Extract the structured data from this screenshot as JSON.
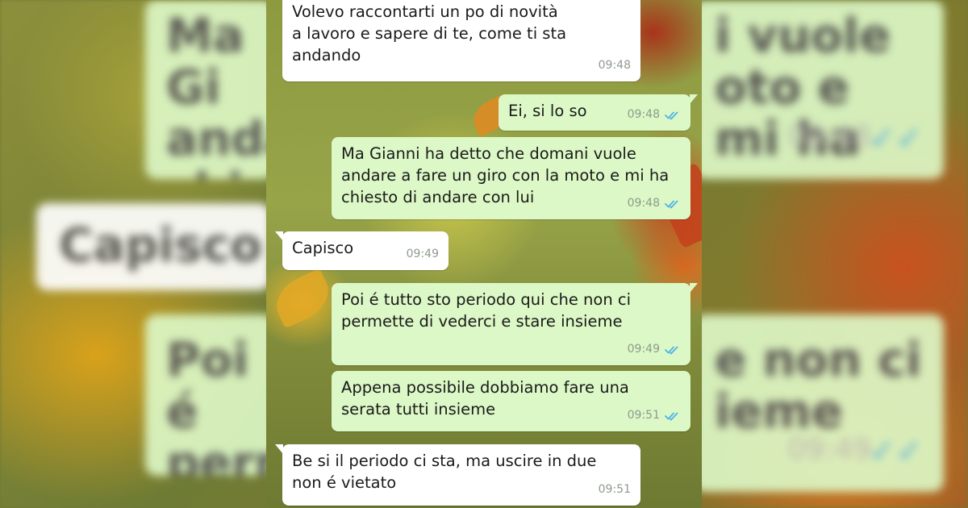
{
  "messages": [
    {
      "dir": "in",
      "text": "Volevo raccontarti un po di novità\na lavoro e sapere di te, come ti sta\nandando",
      "time": "09:48"
    },
    {
      "dir": "out",
      "text": "Ei, si lo so",
      "time": "09:48",
      "status": "read"
    },
    {
      "dir": "out",
      "text": "Ma Gianni ha detto che domani vuole\nandare a fare un giro con la moto e mi ha\nchiesto di andare con lui",
      "time": "09:48",
      "status": "read"
    },
    {
      "dir": "in",
      "text": "Capisco",
      "time": "09:49"
    },
    {
      "dir": "out",
      "text": "Poi é tutto sto periodo qui che non ci\npermette di vederci e stare insieme",
      "time": "09:49",
      "status": "read"
    },
    {
      "dir": "out",
      "text": "Appena possibile dobbiamo fare una\nserata tutti insieme",
      "time": "09:51",
      "status": "read"
    },
    {
      "dir": "in",
      "text": "Be si il periodo ci sta, ma uscire in due\nnon é vietato",
      "time": "09:51"
    }
  ],
  "backdrop": {
    "left_top": "Ma Gi\nanda\nchies",
    "left_mid": "Capisco",
    "left_bottom": "Poi é\nperm",
    "right_top": "i vuole\noto e mi ha",
    "right_top_time": "09:48",
    "right_bottom": "e non ci\nieme",
    "right_bottom_time": "09:49"
  },
  "colors": {
    "incoming_bubble": "#ffffff",
    "outgoing_bubble": "#dcf8c6",
    "read_check": "#4fb3e8",
    "timestamp": "#8e9a8e"
  },
  "icons": {
    "read_status": "double-check-icon"
  }
}
